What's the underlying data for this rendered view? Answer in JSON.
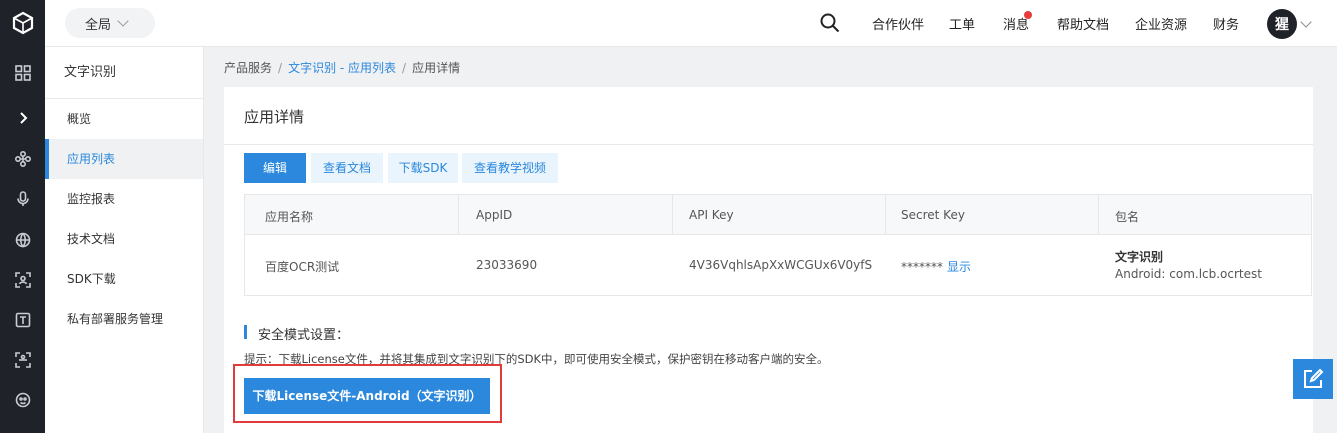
{
  "topbar": {
    "scope_label": "全局",
    "nav": [
      "合作伙伴",
      "工单",
      "消息",
      "帮助文档",
      "企业资源",
      "财务"
    ],
    "avatar_text": "猩"
  },
  "sidebar": {
    "title": "文字识别",
    "items": [
      "概览",
      "应用列表",
      "监控报表",
      "技术文档",
      "SDK下载",
      "私有部署服务管理"
    ],
    "active_index": 1
  },
  "breadcrumb": {
    "root": "产品服务",
    "link": "文字识别 - 应用列表",
    "current": "应用详情",
    "separator": "/"
  },
  "detail": {
    "title": "应用详情",
    "buttons": [
      "编辑",
      "查看文档",
      "下载SDK",
      "查看教学视频"
    ],
    "table": {
      "headers": [
        "应用名称",
        "AppID",
        "API Key",
        "Secret Key",
        "包名"
      ],
      "row": {
        "name": "百度OCR测试",
        "appid": "23033690",
        "api_key": "4V36VqhlsApXxWCGUx6V0yfS",
        "secret_masked": "*******",
        "secret_show": "显示",
        "package_title": "文字识别",
        "package_value": "Android: com.lcb.ocrtest"
      }
    },
    "security_title": "安全模式设置：",
    "hint": "提示：下载License文件，并将其集成到文字识别下的SDK中，即可使用安全模式，保护密钥在移动客户端的安全。",
    "download_button": "下载License文件-Android（文字识别）"
  },
  "colors": {
    "primary": "#2b88dc",
    "rail": "#1f2329",
    "highlight": "#e23b3b",
    "badge": "#e73c3c"
  },
  "icons": {
    "rail": [
      "logo-cube-icon",
      "grid-icon",
      "chevron-right-icon",
      "nodes-icon",
      "microphone-icon",
      "globe-icon",
      "scan-icon",
      "text-icon",
      "face-scan-icon",
      "face-detect-icon"
    ],
    "topbar": [
      "search-icon",
      "chevron-down-icon"
    ],
    "float": "edit-icon"
  }
}
